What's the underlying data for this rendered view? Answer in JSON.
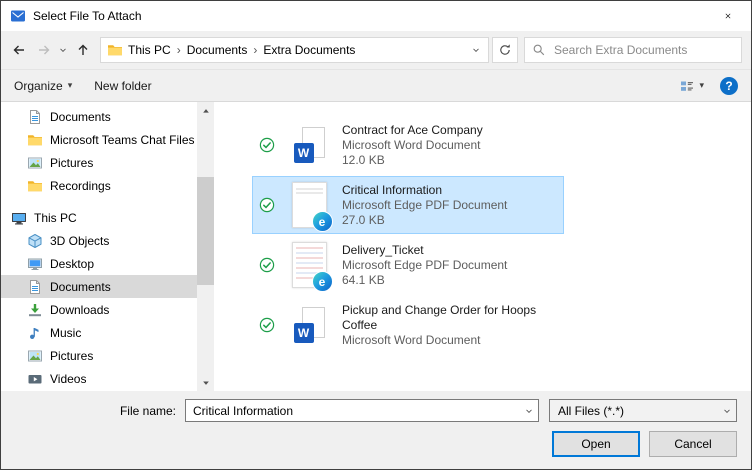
{
  "window": {
    "title": "Select File To Attach"
  },
  "nav": {
    "crumbs": [
      "This PC",
      "Documents",
      "Extra Documents"
    ],
    "crumb_separator": "›",
    "search_placeholder": "Search Extra Documents"
  },
  "toolbar": {
    "organize_label": "Organize",
    "new_folder_label": "New folder"
  },
  "icons": {
    "caret_down": "▾",
    "help_glyph": "?",
    "word_glyph": "W",
    "edge_glyph": "e"
  },
  "sidebar": {
    "items": [
      {
        "label": "Documents"
      },
      {
        "label": "Microsoft Teams Chat Files"
      },
      {
        "label": "Pictures"
      },
      {
        "label": "Recordings"
      },
      {
        "label": "This PC"
      },
      {
        "label": "3D Objects"
      },
      {
        "label": "Desktop"
      },
      {
        "label": "Documents"
      },
      {
        "label": "Downloads"
      },
      {
        "label": "Music"
      },
      {
        "label": "Pictures"
      },
      {
        "label": "Videos"
      }
    ]
  },
  "files": [
    {
      "name": "Contract for Ace Company",
      "type": "Microsoft Word Document",
      "size": "12.0 KB"
    },
    {
      "name": "Critical Information",
      "type": "Microsoft Edge PDF Document",
      "size": "27.0 KB"
    },
    {
      "name": "Delivery_Ticket",
      "type": "Microsoft Edge PDF Document",
      "size": "64.1 KB"
    },
    {
      "name": "Pickup and Change Order for Hoops Coffee",
      "type": "Microsoft Word Document",
      "size": ""
    }
  ],
  "footer": {
    "file_name_label": "File name:",
    "file_name_value": "Critical Information",
    "file_type_value": "All Files (*.*)",
    "open_label": "Open",
    "cancel_label": "Cancel"
  },
  "colors": {
    "selection_fill": "#cce8ff",
    "selection_border": "#99d1ff",
    "accent": "#0078d7"
  }
}
